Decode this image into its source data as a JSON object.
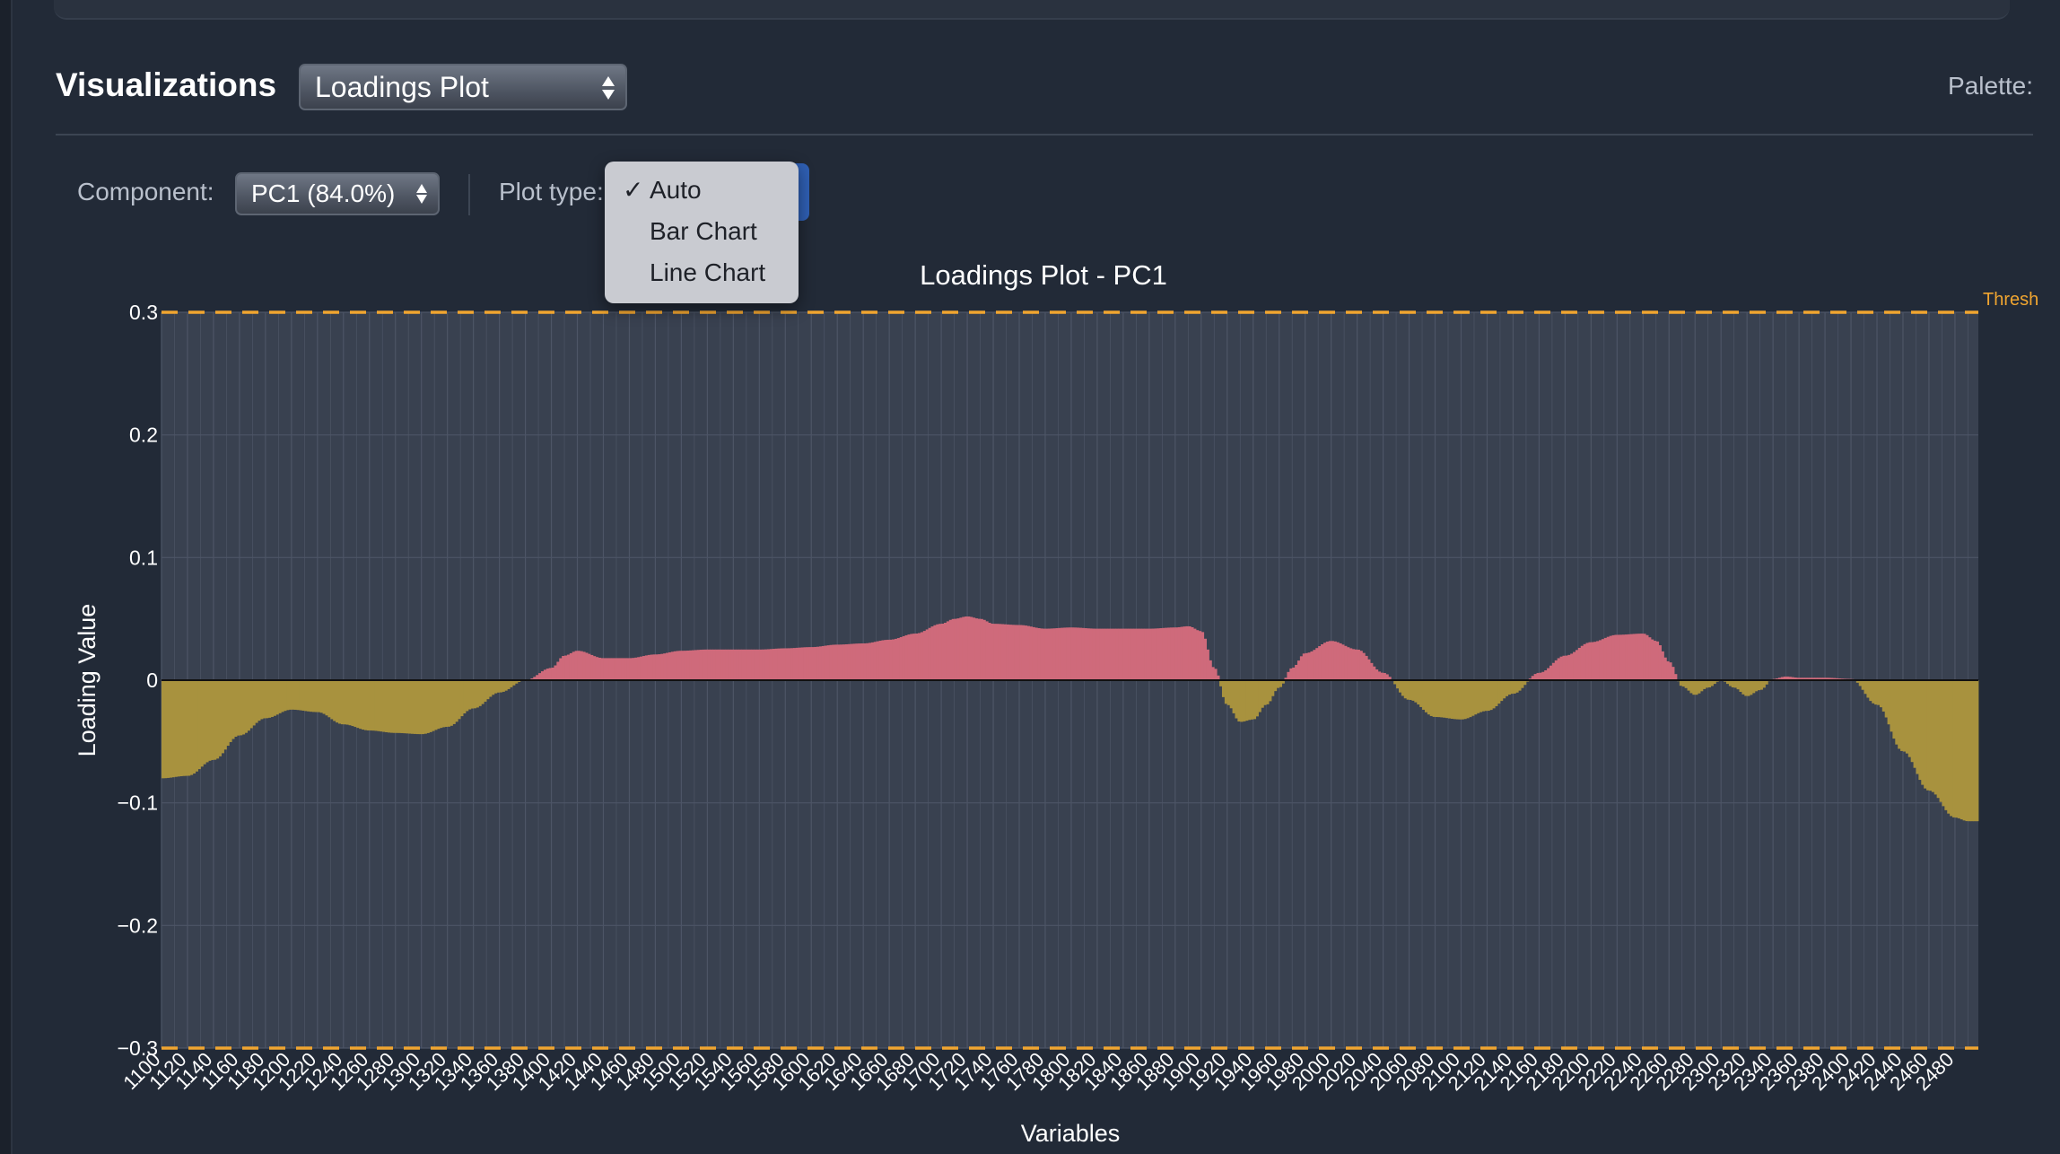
{
  "header": {
    "title": "Visualizations",
    "viz_select_value": "Loadings Plot",
    "palette_label": "Palette:"
  },
  "controls": {
    "component_label": "Component:",
    "component_value": "PC1 (84.0%)",
    "plot_type_label": "Plot type:",
    "plot_type_options": [
      {
        "label": "Auto",
        "checked": true
      },
      {
        "label": "Bar Chart",
        "checked": false
      },
      {
        "label": "Line Chart",
        "checked": false
      }
    ]
  },
  "colors": {
    "positive": "#cf6a7b",
    "negative": "#a8923e",
    "threshold": "#f0a530",
    "plot_bg": "#394150",
    "grid": "#4d5566"
  },
  "chart_data": {
    "type": "bar",
    "title": "Loadings Plot - PC1",
    "xlabel": "Variables",
    "ylabel": "Loading Value",
    "xlim": [
      1100,
      2498
    ],
    "ylim": [
      -0.3,
      0.3
    ],
    "x_ticks": [
      1100,
      1120,
      1140,
      1160,
      1180,
      1200,
      1220,
      1240,
      1260,
      1280,
      1300,
      1320,
      1340,
      1360,
      1380,
      1400,
      1420,
      1440,
      1460,
      1480,
      1500,
      1520,
      1540,
      1560,
      1580,
      1600,
      1620,
      1640,
      1660,
      1680,
      1700,
      1720,
      1740,
      1760,
      1780,
      1800,
      1820,
      1840,
      1860,
      1880,
      1900,
      1920,
      1940,
      1960,
      1980,
      2000,
      2020,
      2040,
      2060,
      2080,
      2100,
      2120,
      2140,
      2160,
      2180,
      2200,
      2220,
      2240,
      2260,
      2280,
      2300,
      2320,
      2340,
      2360,
      2380,
      2400,
      2420,
      2440,
      2460,
      2480
    ],
    "y_ticks": [
      0.3,
      0.2,
      0.1,
      0,
      -0.1,
      -0.2,
      -0.3
    ],
    "y_tick_labels": [
      "0.3",
      "0.2",
      "0.1",
      "0",
      "−0.1",
      "−0.2",
      "−0.3"
    ],
    "threshold": {
      "label": "Thresh",
      "values": [
        0.3,
        -0.3
      ]
    },
    "grid": true,
    "series": [
      {
        "x": [
          1100,
          1120,
          1140,
          1160,
          1180,
          1200,
          1220,
          1240,
          1260,
          1280,
          1300,
          1320,
          1340,
          1360,
          1380,
          1400,
          1410,
          1420,
          1440,
          1460,
          1480,
          1500,
          1520,
          1540,
          1560,
          1580,
          1600,
          1620,
          1640,
          1660,
          1680,
          1700,
          1710,
          1720,
          1730,
          1740,
          1760,
          1780,
          1800,
          1820,
          1840,
          1860,
          1880,
          1890,
          1900,
          1910,
          1920,
          1930,
          1940,
          1950,
          1960,
          1970,
          1980,
          2000,
          2020,
          2040,
          2060,
          2080,
          2100,
          2120,
          2140,
          2160,
          2180,
          2200,
          2220,
          2240,
          2250,
          2260,
          2270,
          2280,
          2290,
          2300,
          2310,
          2320,
          2330,
          2340,
          2350,
          2360,
          2380,
          2400,
          2420,
          2440,
          2460,
          2480,
          2490,
          2498
        ],
        "values": [
          -0.08,
          -0.078,
          -0.065,
          -0.045,
          -0.031,
          -0.024,
          -0.026,
          -0.036,
          -0.041,
          -0.043,
          -0.044,
          -0.038,
          -0.023,
          -0.01,
          0.0,
          0.01,
          0.02,
          0.024,
          0.018,
          0.018,
          0.021,
          0.024,
          0.025,
          0.025,
          0.025,
          0.026,
          0.027,
          0.029,
          0.03,
          0.033,
          0.038,
          0.046,
          0.05,
          0.052,
          0.05,
          0.046,
          0.045,
          0.042,
          0.043,
          0.042,
          0.042,
          0.042,
          0.043,
          0.044,
          0.04,
          0.01,
          -0.02,
          -0.034,
          -0.032,
          -0.02,
          -0.006,
          0.01,
          0.022,
          0.032,
          0.025,
          0.006,
          -0.016,
          -0.03,
          -0.032,
          -0.025,
          -0.011,
          0.006,
          0.02,
          0.031,
          0.037,
          0.038,
          0.032,
          0.015,
          -0.005,
          -0.012,
          -0.006,
          0.0,
          -0.006,
          -0.013,
          -0.008,
          0.001,
          0.003,
          0.002,
          0.002,
          0.001,
          -0.02,
          -0.058,
          -0.09,
          -0.112,
          -0.115,
          -0.115
        ]
      }
    ]
  }
}
